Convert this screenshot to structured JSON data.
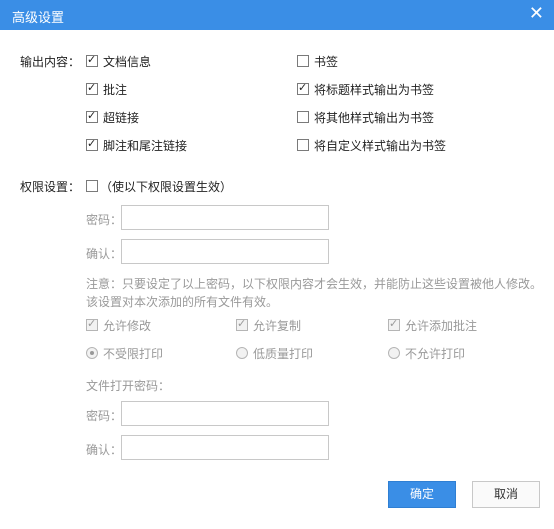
{
  "dialog": {
    "title": "高级设置",
    "close_glyph": "✕"
  },
  "output": {
    "label": "输出内容：",
    "left": [
      {
        "label": "文档信息",
        "checked": true
      },
      {
        "label": "批注",
        "checked": true
      },
      {
        "label": "超链接",
        "checked": true
      },
      {
        "label": "脚注和尾注链接",
        "checked": true
      }
    ],
    "right": [
      {
        "label": "书签",
        "checked": false
      },
      {
        "label": "将标题样式输出为书签",
        "checked": true
      },
      {
        "label": "将其他样式输出为书签",
        "checked": false
      },
      {
        "label": "将自定义样式输出为书签",
        "checked": false
      }
    ]
  },
  "permissions": {
    "label": "权限设置：",
    "enable_label": "（使以下权限设置生效）",
    "enable_checked": false,
    "password_label": "密码：",
    "confirm_label": "确认：",
    "password_value": "",
    "confirm_value": "",
    "note_line1": "注意：只要设定了以上密码，以下权限内容才会生效，并能防止这些设置被他人修改。",
    "note_line2": "该设置对本次添加的所有文件有效。",
    "allow": [
      {
        "label": "允许修改",
        "checked": true
      },
      {
        "label": "允许复制",
        "checked": true
      },
      {
        "label": "允许添加批注",
        "checked": true
      }
    ],
    "print": [
      {
        "label": "不受限打印",
        "selected": true
      },
      {
        "label": "低质量打印",
        "selected": false
      },
      {
        "label": "不允许打印",
        "selected": false
      }
    ]
  },
  "open_password": {
    "label": "文件打开密码：",
    "password_label": "密码：",
    "confirm_label": "确认：",
    "password_value": "",
    "confirm_value": ""
  },
  "buttons": {
    "ok": "确定",
    "cancel": "取消"
  }
}
